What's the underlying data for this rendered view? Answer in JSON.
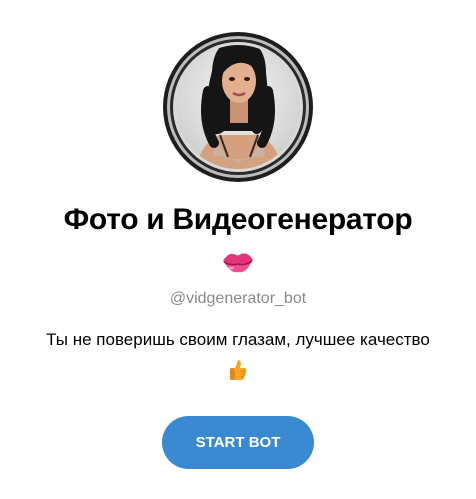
{
  "bot": {
    "title": "Фото и Видеогенератор",
    "title_emoji": "kiss-lips-icon",
    "username": "@vidgenerator_bot",
    "description": "Ты не поверишь своим глазам, лучшее качество",
    "description_emoji": "thumbs-up-icon"
  },
  "actions": {
    "start_label": "START BOT"
  },
  "colors": {
    "button_bg": "#3a8ad1",
    "username_text": "#8a8a8a",
    "background": "#ffffff"
  }
}
